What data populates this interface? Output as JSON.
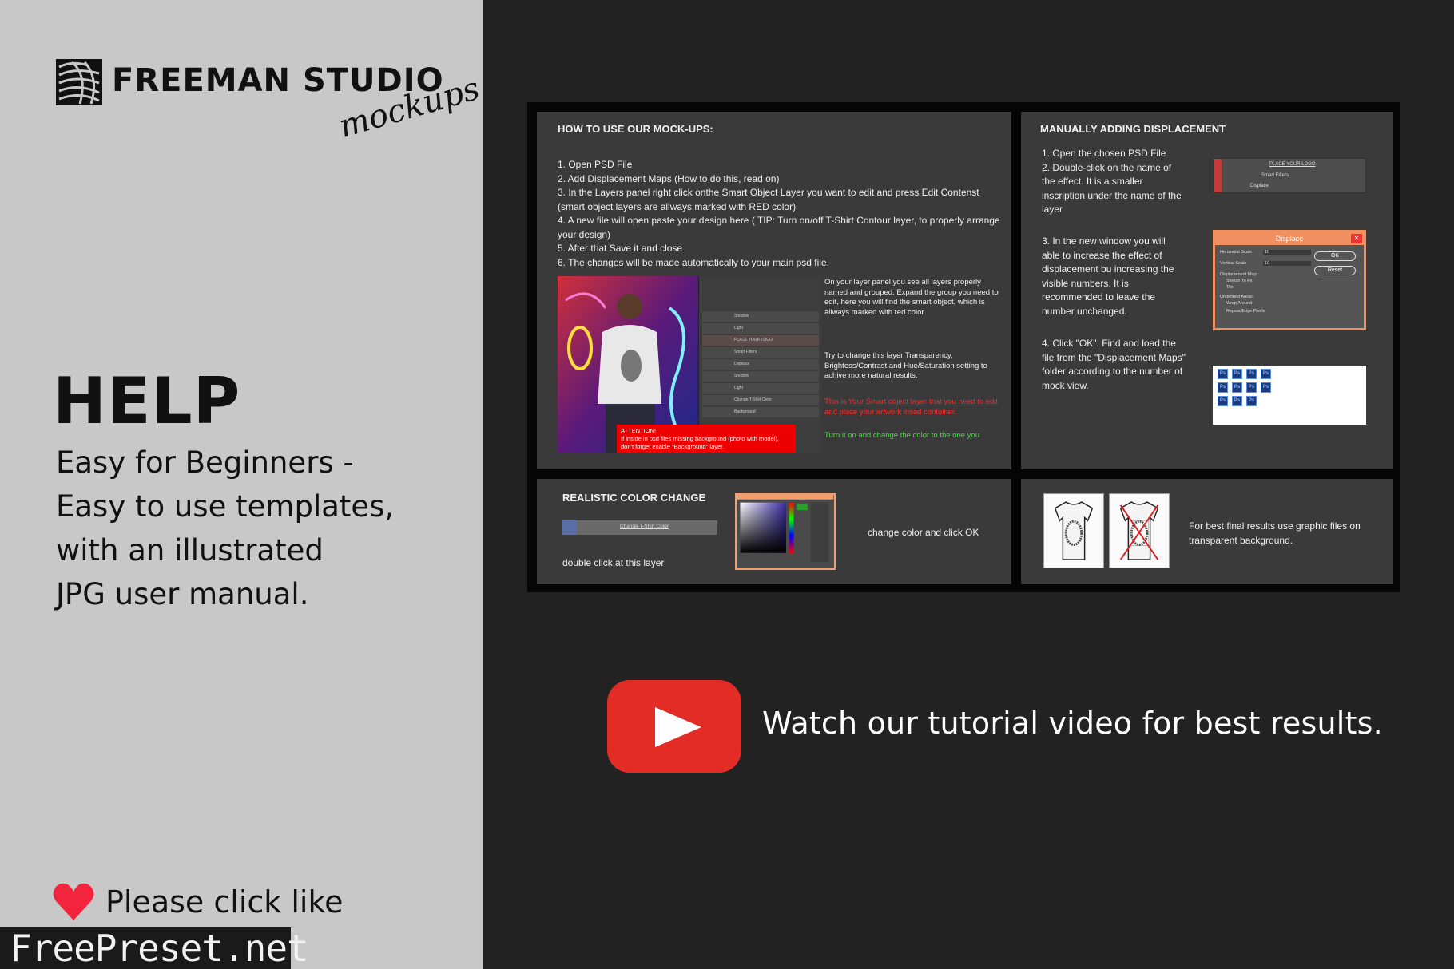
{
  "brand": {
    "name": "FREEMAN STUDIO",
    "subtitle": "mockups"
  },
  "help": {
    "title": "HELP",
    "lines": [
      "Easy for Beginners -",
      "Easy to use templates,",
      "with an illustrated",
      "JPG user manual."
    ]
  },
  "like": {
    "label": "Please click like",
    "icon": "heart-icon",
    "color": "#f2253d"
  },
  "watermark": {
    "text": "FreePreset.net"
  },
  "manual": {
    "howto": {
      "title": "HOW TO USE OUR MOCK-UPS:",
      "steps": [
        "1.  Open PSD File",
        "2.  Add Displacement Maps (How to do this, read on)",
        "3.  In the Layers panel right click onthe Smart Object Layer you want to edit and press Edit Contenst (smart object layers are allways marked with RED color)",
        "4.  A new file will open paste your design here ( TIP: Turn on/off T-Shirt Contour layer, to properly arrange your design)",
        "5.  After that Save it and close",
        "6.  The changes will be made automatically to your main psd file."
      ],
      "layers": [
        "Shadow",
        "Light",
        "PLACE YOUR LOGO",
        "Smart Filters",
        "Displace",
        "Shadow",
        "Light",
        "Change T-Shirt Color",
        "Background"
      ],
      "notes": {
        "panel": "On your layer panel you see all layers properly named and grouped. Expand the group you need to edit, here you will find the smart object, which is allways marked with red color",
        "transparency": "Try to change this layer Transparency, Brightess/Contrast and Hue/Saturation setting to achive more natural results.",
        "smart": "This is Your Smart object layer that you need to edit and place your artwork insed container.",
        "color": "Turn it on and change the color to the one you"
      },
      "attention": {
        "title": "ATTENTION!",
        "lines": [
          "If inside in psd files missing background (photo with model),",
          "don't forget enable \"Background\" layer."
        ]
      }
    },
    "displacement": {
      "title": "MANUALLY ADDING DISPLACEMENT",
      "steps": [
        "1. Open the chosen PSD File\n2. Double-click on the name of the effect. It is a smaller inscription under the name of the layer",
        "3. In the new window you will able to increase the effect of displacement bu increasing the visible numbers. It is recommended to leave the number unchanged.",
        "4. Click \"OK\". Find and load the file from the \"Displacement Maps\" folder according to the number of mock view."
      ],
      "mini_layer": {
        "name": "PLACE YOUR LOGO",
        "filters": "Smart Filters",
        "effect": "Displace"
      },
      "dialog": {
        "title": "Displace",
        "ok": "OK",
        "reset": "Reset",
        "labels": [
          "Horizontal Scale",
          "Vertical Scale",
          "Displacement Map:",
          "Stretch To Fit",
          "Tile",
          "Undefined Areas:",
          "Wrap Around",
          "Repeat Edge Pixels"
        ],
        "h_value": "10",
        "v_value": "10"
      },
      "ps_icon_label": "Ps",
      "ps_icon_count": 11
    },
    "color_change": {
      "title": "REALISTIC  COLOR CHANGE",
      "layer_name": "Change T-Shirt Color",
      "hint": "double click at this layer",
      "action": "change color and click OK"
    },
    "best_results": {
      "text": "For best final results use graphic files on transparent background."
    }
  },
  "video": {
    "label": "Watch our tutorial video for best results.",
    "icon": "youtube-play-icon",
    "color": "#e32c26"
  }
}
